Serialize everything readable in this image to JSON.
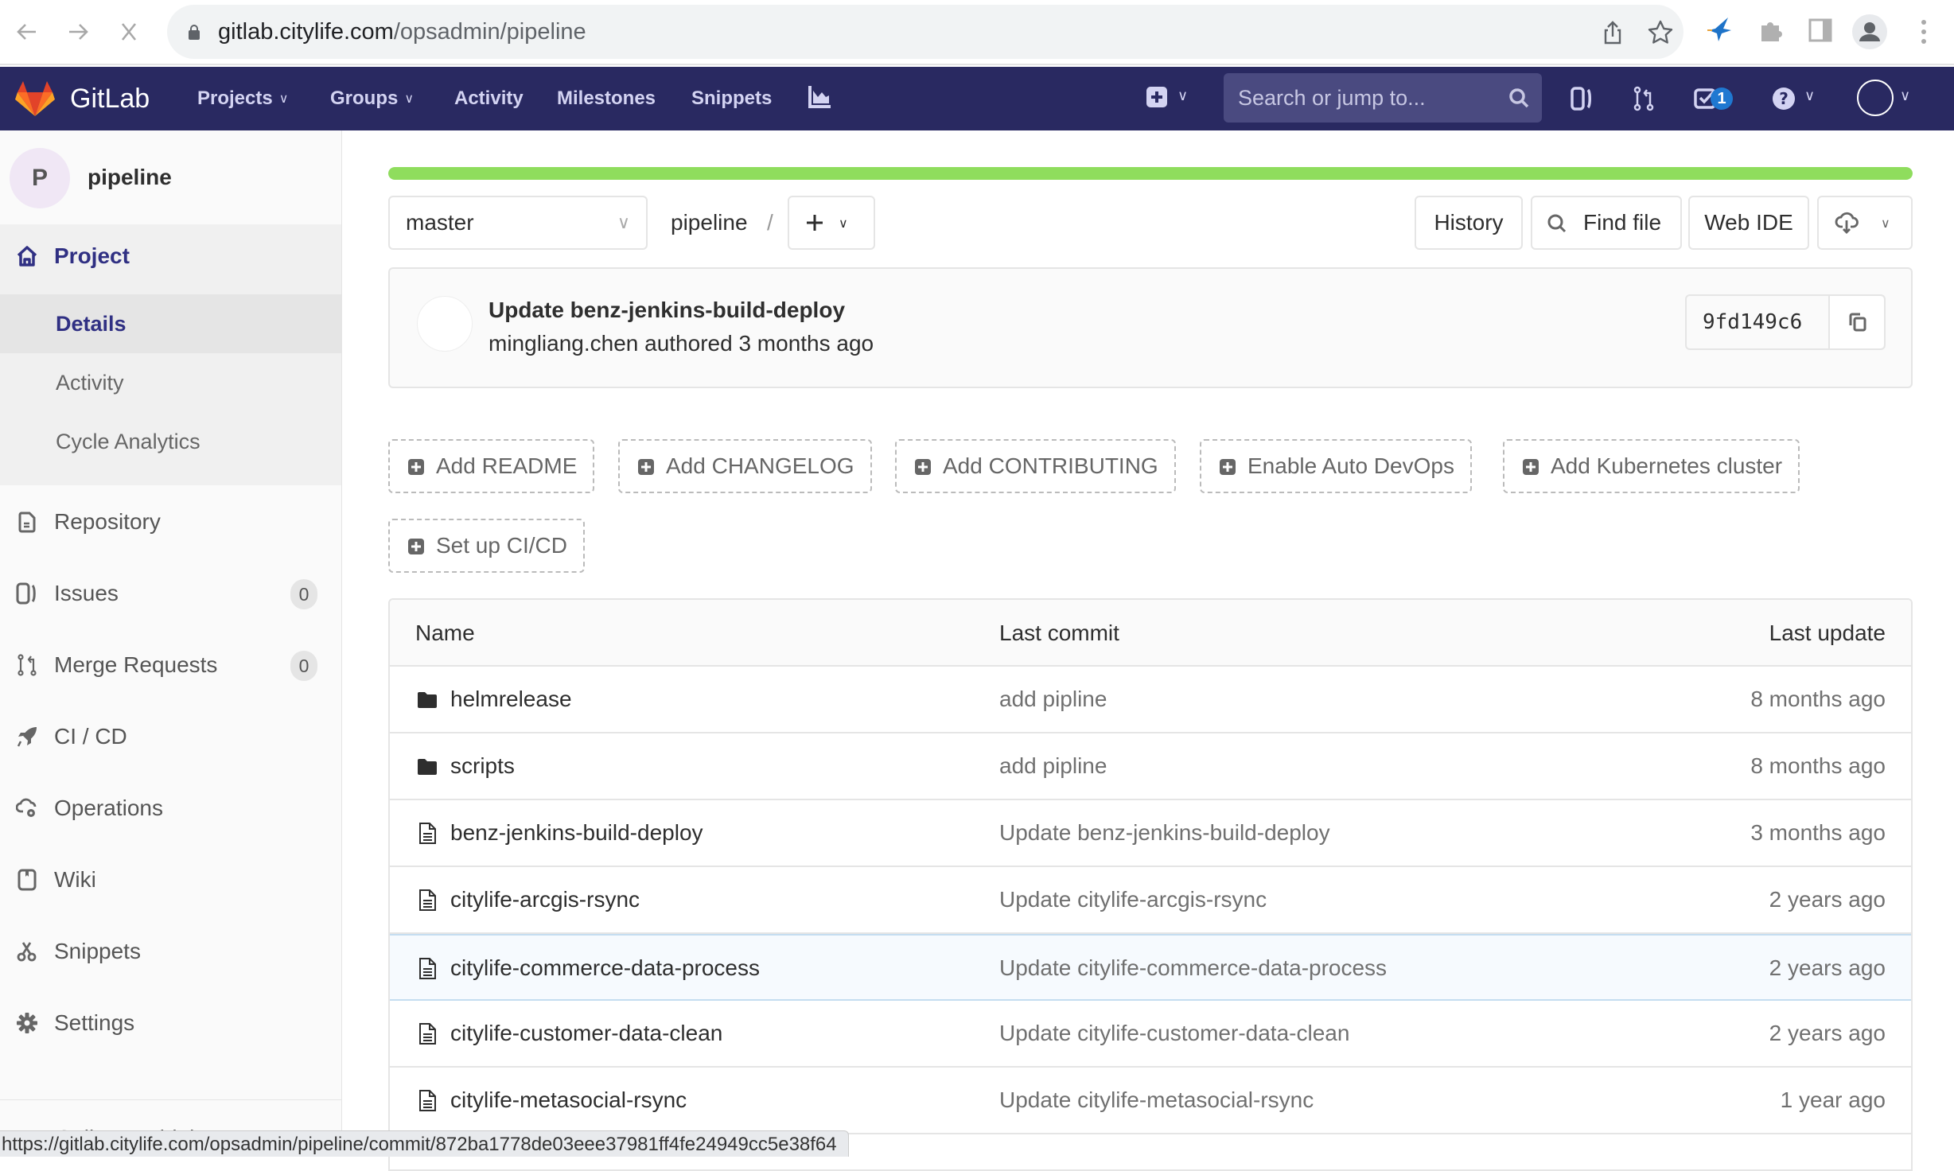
{
  "browser": {
    "url_host": "gitlab.citylife.com",
    "url_path": "/opsadmin/pipeline",
    "status_url": "https://gitlab.citylife.com/opsadmin/pipeline/commit/872ba1778de03eee37981ff4fe24949cc5e38f64"
  },
  "topnav": {
    "brand": "GitLab",
    "links": [
      {
        "label": "Projects",
        "dropdown": true
      },
      {
        "label": "Groups",
        "dropdown": true
      },
      {
        "label": "Activity",
        "dropdown": false
      },
      {
        "label": "Milestones",
        "dropdown": false
      },
      {
        "label": "Snippets",
        "dropdown": false
      }
    ],
    "search_placeholder": "Search or jump to...",
    "todo_count": "1",
    "colors": {
      "bar": "#292961",
      "todo_badge": "#1f78d1"
    }
  },
  "sidebar": {
    "project_initial": "P",
    "project_name": "pipeline",
    "project_section": {
      "label": "Project",
      "subitems": [
        {
          "label": "Details",
          "selected": true
        },
        {
          "label": "Activity",
          "selected": false
        },
        {
          "label": "Cycle Analytics",
          "selected": false
        }
      ]
    },
    "items": [
      {
        "label": "Repository",
        "icon": "repository-icon"
      },
      {
        "label": "Issues",
        "icon": "issues-icon",
        "count": "0"
      },
      {
        "label": "Merge Requests",
        "icon": "merge-request-icon",
        "count": "0"
      },
      {
        "label": "CI / CD",
        "icon": "rocket-icon"
      },
      {
        "label": "Operations",
        "icon": "cloud-gear-icon"
      },
      {
        "label": "Wiki",
        "icon": "book-icon"
      },
      {
        "label": "Snippets",
        "icon": "scissors-icon"
      },
      {
        "label": "Settings",
        "icon": "gear-icon"
      }
    ],
    "collapse_label": "Collapse sidebar"
  },
  "main": {
    "progress_percent": 100,
    "progress_color": "#8fdd5d",
    "branch": "master",
    "breadcrumb_project": "pipeline",
    "breadcrumb_sep": "/",
    "actions": {
      "history": "History",
      "find_file": "Find file",
      "web_ide": "Web IDE"
    },
    "last_commit": {
      "title": "Update benz-jenkins-build-deploy",
      "meta": "mingliang.chen authored 3 months ago",
      "sha": "9fd149c6"
    },
    "quick_actions": [
      "Add README",
      "Add CHANGELOG",
      "Add CONTRIBUTING",
      "Enable Auto DevOps",
      "Add Kubernetes cluster",
      "Set up CI/CD"
    ],
    "table": {
      "headers": {
        "name": "Name",
        "last_commit": "Last commit",
        "last_update": "Last update"
      },
      "rows": [
        {
          "type": "folder",
          "name": "helmrelease",
          "commit": "add pipline",
          "updated": "8 months ago"
        },
        {
          "type": "folder",
          "name": "scripts",
          "commit": "add pipline",
          "updated": "8 months ago"
        },
        {
          "type": "file",
          "name": "benz-jenkins-build-deploy",
          "commit": "Update benz-jenkins-build-deploy",
          "updated": "3 months ago"
        },
        {
          "type": "file",
          "name": "citylife-arcgis-rsync",
          "commit": "Update citylife-arcgis-rsync",
          "updated": "2 years ago"
        },
        {
          "type": "file",
          "name": "citylife-commerce-data-process",
          "commit": "Update citylife-commerce-data-process",
          "updated": "2 years ago",
          "hover": true
        },
        {
          "type": "file",
          "name": "citylife-customer-data-clean",
          "commit": "Update citylife-customer-data-clean",
          "updated": "2 years ago"
        },
        {
          "type": "file",
          "name": "citylife-metasocial-rsync",
          "commit": "Update citylife-metasocial-rsync",
          "updated": "1 year ago"
        }
      ]
    }
  }
}
